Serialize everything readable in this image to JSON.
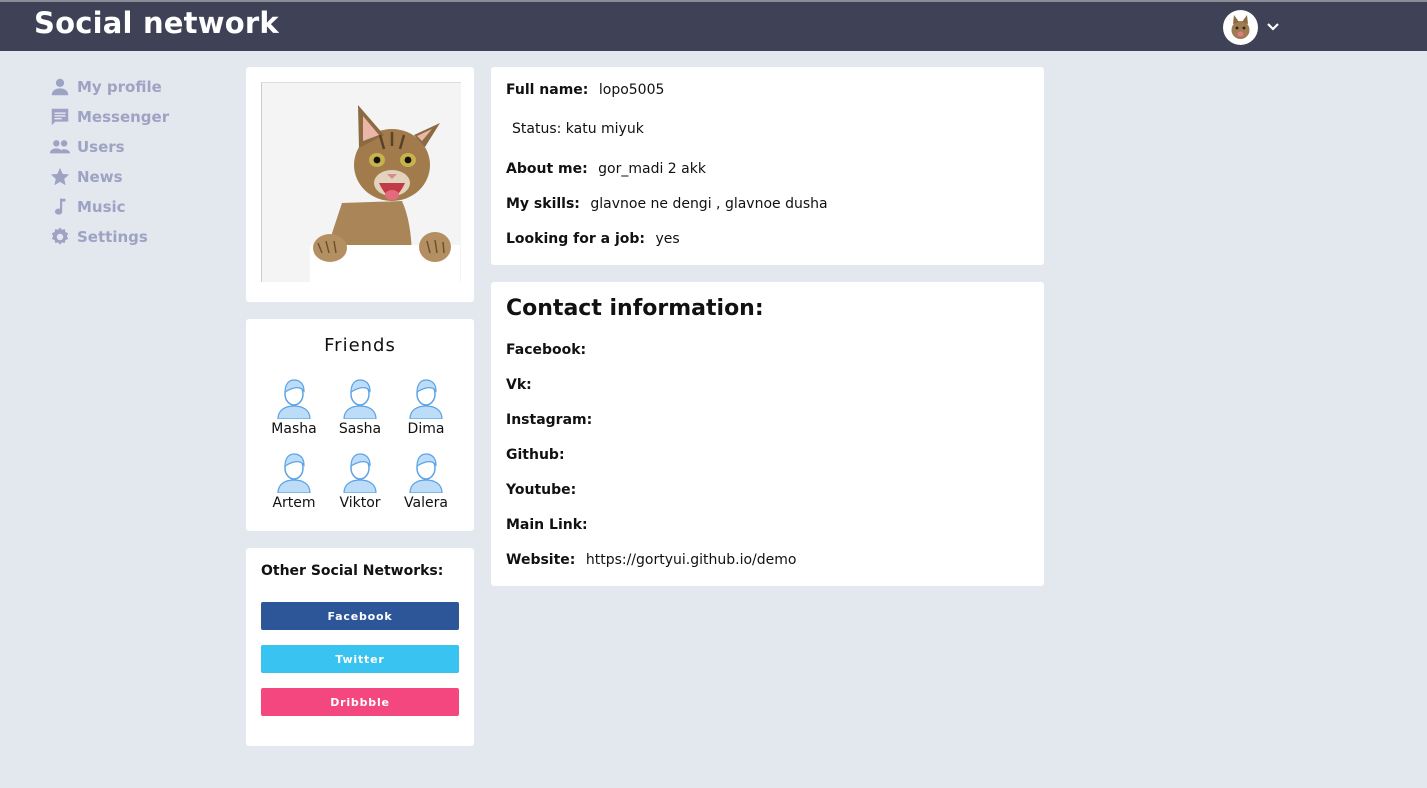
{
  "app": {
    "title": "Social network"
  },
  "sidebar": {
    "items": [
      {
        "label": "My profile",
        "icon": "person-icon"
      },
      {
        "label": "Messenger",
        "icon": "message-icon"
      },
      {
        "label": "Users",
        "icon": "users-icon"
      },
      {
        "label": "News",
        "icon": "star-icon"
      },
      {
        "label": "Music",
        "icon": "music-note-icon"
      },
      {
        "label": "Settings",
        "icon": "gear-icon"
      }
    ]
  },
  "friends": {
    "title": "Friends",
    "list": [
      "Masha",
      "Sasha",
      "Dima",
      "Artem",
      "Viktor",
      "Valera"
    ]
  },
  "networks": {
    "title": "Other Social Networks:",
    "buttons": [
      {
        "label": "Facebook",
        "color": "#2d5699"
      },
      {
        "label": "Twitter",
        "color": "#38c3f1"
      },
      {
        "label": "Dribbble",
        "color": "#f4477f"
      }
    ]
  },
  "profile": {
    "full_name_label": "Full name:",
    "full_name": "lopo5005",
    "status": "Status: katu miyuk",
    "about_label": "About me:",
    "about": "gor_madi 2 akk",
    "skills_label": "My skills:",
    "skills": "glavnoe ne dengi , glavnoe dusha",
    "job_label": "Looking for a job:",
    "job": "yes"
  },
  "contacts": {
    "title": "Contact information:",
    "facebook_label": "Facebook:",
    "vk_label": "Vk:",
    "instagram_label": "Instagram:",
    "github_label": "Github:",
    "youtube_label": "Youtube:",
    "mainlink_label": "Main Link:",
    "website_label": "Website:",
    "website": "https://gortyui.github.io/demo"
  },
  "colors": {
    "header": "#3f4257",
    "background": "#e2e8ee",
    "sidebar_text": "#9ea3c4"
  }
}
